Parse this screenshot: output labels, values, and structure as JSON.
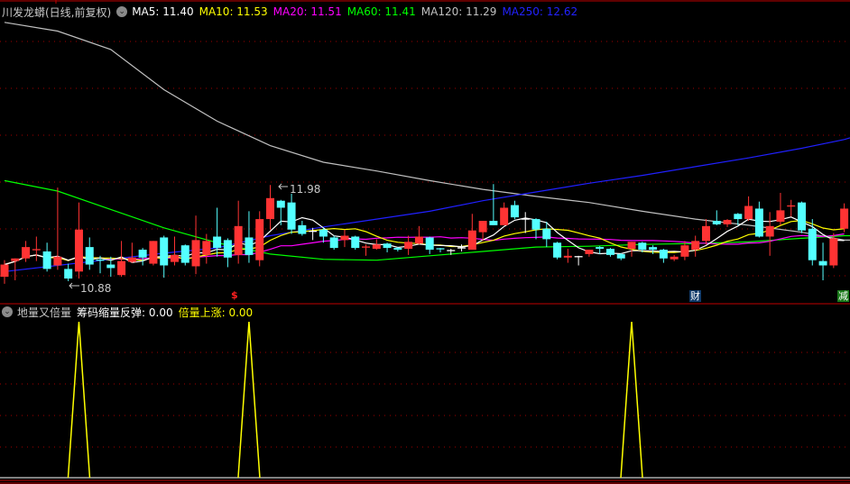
{
  "main": {
    "title": "川发龙蟒(日线,前复权)",
    "toggle_icon": "chevron-down-circle-icon",
    "ma_legend": [
      {
        "label": "MA5: 11.40",
        "color": "#ffffff"
      },
      {
        "label": "MA10: 11.53",
        "color": "#ffff00"
      },
      {
        "label": "MA20: 11.51",
        "color": "#ff00ff"
      },
      {
        "label": "MA60: 11.41",
        "color": "#00ff00"
      },
      {
        "label": "MA120: 11.29",
        "color": "#c0c0c0"
      },
      {
        "label": "MA250: 12.62",
        "color": "#0000ff"
      }
    ],
    "high_label": "11.98",
    "low_label": "10.88",
    "markers": {
      "dollar": "$",
      "cai": "财",
      "jian": "减"
    }
  },
  "sub": {
    "title": "地量又倍量",
    "legend": [
      {
        "label": "筹码缩量反弹: 0.00",
        "color": "#ffffff"
      },
      {
        "label": "倍量上涨: 0.00",
        "color": "#ffff00"
      }
    ]
  },
  "colors": {
    "up": "#ff3333",
    "down": "#54ffff",
    "flat": "#ffffff",
    "grid": "#a00000",
    "border": "#c00000"
  },
  "chart_data": [
    {
      "type": "candlestick",
      "title": "川发龙蟒(日线,前复权)",
      "ylim": [
        10.6,
        14.1
      ],
      "annotations": [
        {
          "index": 25,
          "text": "11.98"
        },
        {
          "index": 6,
          "text": "10.88"
        }
      ],
      "ohlc": [
        [
          10.93,
          11.12,
          10.85,
          11.07
        ],
        [
          11.11,
          11.14,
          10.89,
          11.14
        ],
        [
          11.14,
          11.34,
          11.1,
          11.27
        ],
        [
          11.23,
          11.39,
          11.11,
          11.24
        ],
        [
          11.22,
          11.32,
          10.99,
          11.02
        ],
        [
          11.06,
          11.95,
          11.01,
          11.16
        ],
        [
          11.02,
          11.08,
          10.88,
          10.91
        ],
        [
          10.99,
          11.78,
          10.91,
          11.47
        ],
        [
          11.27,
          11.38,
          11.01,
          11.07
        ],
        [
          11.12,
          11.17,
          10.97,
          11.11
        ],
        [
          11.07,
          11.16,
          10.93,
          11.03
        ],
        [
          10.95,
          11.34,
          10.93,
          11.11
        ],
        [
          11.1,
          11.32,
          11.09,
          11.15
        ],
        [
          11.24,
          11.26,
          11.06,
          11.15
        ],
        [
          11.08,
          11.34,
          11.06,
          11.34
        ],
        [
          11.38,
          11.4,
          10.92,
          11.06
        ],
        [
          11.1,
          11.39,
          11.06,
          11.18
        ],
        [
          11.29,
          11.3,
          11.06,
          11.09
        ],
        [
          11.05,
          11.63,
          10.96,
          11.35
        ],
        [
          11.18,
          11.42,
          11.08,
          11.34
        ],
        [
          11.39,
          11.72,
          11.16,
          11.26
        ],
        [
          11.35,
          11.37,
          11.04,
          11.15
        ],
        [
          11.18,
          11.8,
          11.08,
          11.51
        ],
        [
          11.38,
          11.68,
          11.09,
          11.18
        ],
        [
          11.12,
          11.68,
          11.05,
          11.59
        ],
        [
          11.59,
          11.98,
          11.47,
          11.83
        ],
        [
          11.8,
          11.81,
          11.52,
          11.72
        ],
        [
          11.78,
          11.88,
          11.42,
          11.47
        ],
        [
          11.52,
          11.57,
          11.4,
          11.42
        ],
        [
          11.45,
          11.49,
          11.35,
          11.45
        ],
        [
          11.47,
          11.49,
          11.32,
          11.39
        ],
        [
          11.38,
          11.4,
          11.24,
          11.26
        ],
        [
          11.35,
          11.47,
          11.27,
          11.4
        ],
        [
          11.39,
          11.4,
          11.24,
          11.26
        ],
        [
          11.26,
          11.3,
          11.17,
          11.27
        ],
        [
          11.25,
          11.36,
          11.24,
          11.3
        ],
        [
          11.31,
          11.32,
          11.21,
          11.26
        ],
        [
          11.26,
          11.27,
          11.22,
          11.24
        ],
        [
          11.25,
          11.4,
          11.18,
          11.33
        ],
        [
          11.31,
          11.51,
          11.3,
          11.39
        ],
        [
          11.38,
          11.39,
          11.19,
          11.24
        ],
        [
          11.25,
          11.26,
          11.21,
          11.24
        ],
        [
          11.23,
          11.25,
          11.18,
          11.23
        ],
        [
          11.26,
          11.3,
          11.22,
          11.26
        ],
        [
          11.24,
          11.65,
          11.24,
          11.46
        ],
        [
          11.44,
          11.57,
          11.34,
          11.57
        ],
        [
          11.57,
          11.99,
          11.52,
          11.52
        ],
        [
          11.52,
          11.78,
          11.52,
          11.72
        ],
        [
          11.75,
          11.8,
          11.59,
          11.61
        ],
        [
          11.59,
          11.67,
          11.43,
          11.59
        ],
        [
          11.59,
          11.6,
          11.36,
          11.47
        ],
        [
          11.48,
          11.56,
          11.27,
          11.36
        ],
        [
          11.32,
          11.33,
          11.13,
          11.15
        ],
        [
          11.15,
          11.25,
          11.09,
          11.17
        ],
        [
          11.16,
          11.17,
          11.06,
          11.16
        ],
        [
          11.19,
          11.24,
          11.16,
          11.24
        ],
        [
          11.27,
          11.28,
          11.19,
          11.25
        ],
        [
          11.25,
          11.26,
          11.16,
          11.18
        ],
        [
          11.19,
          11.2,
          11.12,
          11.14
        ],
        [
          11.25,
          11.33,
          11.16,
          11.33
        ],
        [
          11.32,
          11.33,
          11.21,
          11.24
        ],
        [
          11.27,
          11.29,
          11.19,
          11.24
        ],
        [
          11.24,
          11.25,
          11.09,
          11.14
        ],
        [
          11.13,
          11.18,
          11.11,
          11.16
        ],
        [
          11.16,
          11.34,
          11.12,
          11.29
        ],
        [
          11.24,
          11.4,
          11.16,
          11.34
        ],
        [
          11.34,
          11.59,
          11.3,
          11.51
        ],
        [
          11.57,
          11.69,
          11.52,
          11.53
        ],
        [
          11.53,
          11.59,
          11.5,
          11.58
        ],
        [
          11.65,
          11.66,
          11.52,
          11.59
        ],
        [
          11.59,
          11.85,
          11.57,
          11.74
        ],
        [
          11.71,
          11.79,
          11.38,
          11.39
        ],
        [
          11.39,
          11.67,
          11.17,
          11.51
        ],
        [
          11.56,
          11.89,
          11.52,
          11.69
        ],
        [
          11.73,
          11.81,
          11.62,
          11.74
        ],
        [
          11.78,
          11.79,
          11.43,
          11.46
        ],
        [
          11.48,
          11.59,
          11.06,
          11.12
        ],
        [
          11.11,
          11.32,
          10.89,
          11.06
        ],
        [
          11.06,
          11.43,
          11.03,
          11.37
        ],
        [
          11.48,
          11.77,
          11.44,
          11.71
        ]
      ],
      "ma_sampled": {
        "sample_indices": [
          0,
          5,
          10,
          15,
          20,
          25,
          30,
          35,
          40,
          45,
          50,
          55,
          60,
          65,
          70,
          75,
          79
        ],
        "MA60": [
          12.03,
          11.91,
          11.7,
          11.49,
          11.32,
          11.19,
          11.13,
          11.12,
          11.17,
          11.22,
          11.27,
          11.28,
          11.3,
          11.31,
          11.33,
          11.37,
          11.4
        ],
        "MA120": [
          13.84,
          13.74,
          13.53,
          13.07,
          12.71,
          12.43,
          12.24,
          12.14,
          12.03,
          11.93,
          11.85,
          11.78,
          11.68,
          11.59,
          11.52,
          11.44,
          11.35
        ],
        "MA250": [
          10.99,
          11.06,
          11.13,
          11.2,
          11.26,
          11.4,
          11.5,
          11.59,
          11.68,
          11.8,
          11.9,
          12.0,
          12.09,
          12.19,
          12.29,
          12.4,
          12.5
        ]
      }
    },
    {
      "type": "line",
      "title": "地量又倍量",
      "ylim": [
        0,
        1
      ],
      "series": [
        {
          "name": "倍量上涨",
          "spikes": [
            {
              "index": 7,
              "value": 1
            },
            {
              "index": 23,
              "value": 1
            },
            {
              "index": 59,
              "value": 1
            }
          ]
        },
        {
          "name": "筹码缩量反弹",
          "spikes": []
        }
      ]
    }
  ]
}
